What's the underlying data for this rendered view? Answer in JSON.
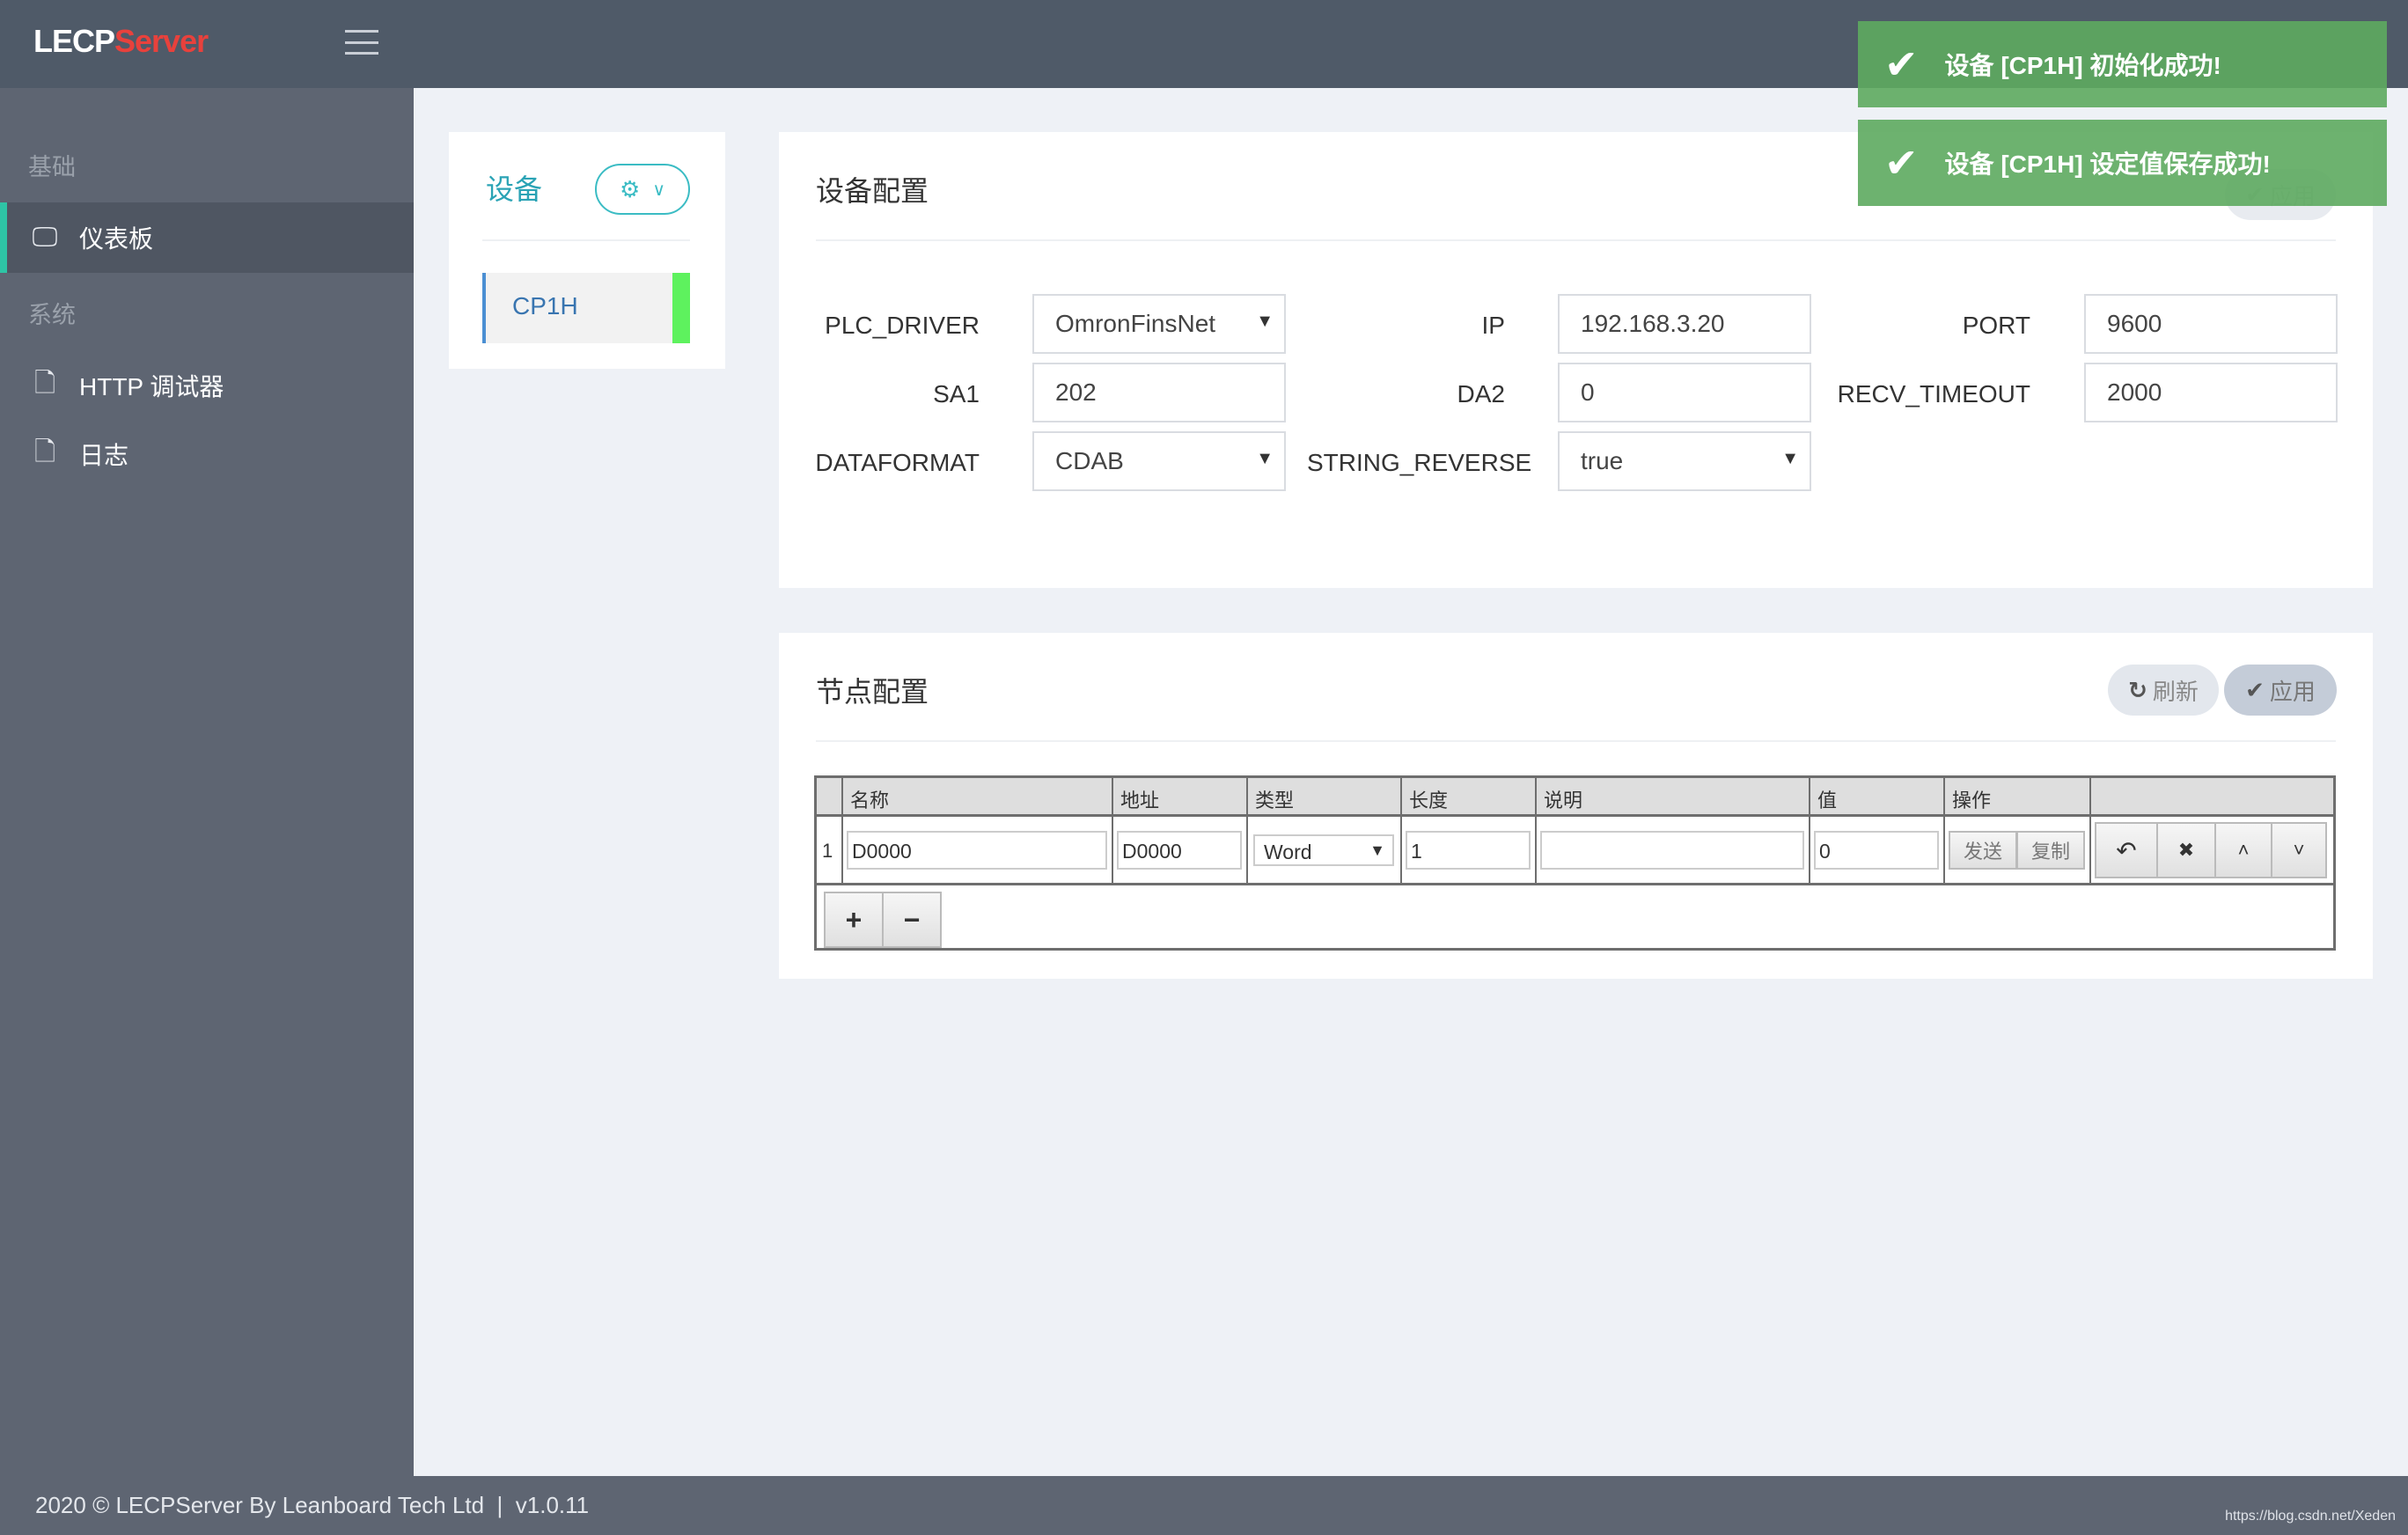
{
  "app": {
    "logo_part1": "LECP",
    "logo_part2": "Server"
  },
  "sidebar": {
    "section1": "基础",
    "section2": "系统",
    "items": [
      {
        "label": "仪表板",
        "icon": "monitor-icon"
      },
      {
        "label": "HTTP 调试器",
        "icon": "file-icon"
      },
      {
        "label": "日志",
        "icon": "file-icon"
      }
    ]
  },
  "devices": {
    "title": "设备",
    "items": [
      {
        "name": "CP1H",
        "status_color": "#5ef25e"
      }
    ]
  },
  "device_config": {
    "title": "设备配置",
    "apply_label": "应用",
    "fields": [
      {
        "label": "PLC_DRIVER",
        "value": "OmronFinsNet",
        "type": "select"
      },
      {
        "label": "IP",
        "value": "192.168.3.20",
        "type": "text"
      },
      {
        "label": "PORT",
        "value": "9600",
        "type": "text"
      },
      {
        "label": "SA1",
        "value": "202",
        "type": "text"
      },
      {
        "label": "DA2",
        "value": "0",
        "type": "text"
      },
      {
        "label": "RECV_TIMEOUT",
        "value": "2000",
        "type": "text"
      },
      {
        "label": "DATAFORMAT",
        "value": "CDAB",
        "type": "select"
      },
      {
        "label": "STRING_REVERSE",
        "value": "true",
        "type": "select"
      }
    ]
  },
  "node_config": {
    "title": "节点配置",
    "refresh_label": "刷新",
    "apply_label": "应用",
    "columns": [
      "名称",
      "地址",
      "类型",
      "长度",
      "说明",
      "值",
      "操作"
    ],
    "rows": [
      {
        "index": "1",
        "name": "D0000",
        "address": "D0000",
        "type": "Word",
        "length": "1",
        "desc": "",
        "value": "0",
        "send": "发送",
        "copy": "复制"
      }
    ]
  },
  "toasts": [
    "设备 [CP1H] 初始化成功!",
    "设备 [CP1H] 设定值保存成功!"
  ],
  "footer": {
    "text": "2020 © LECPServer By Leanboard Tech Ltd  |  v1.0.11",
    "watermark": "https://blog.csdn.net/Xeden"
  },
  "colors": {
    "header": "#4f5a68",
    "sidebar": "#5e6572",
    "accent": "#2ec4a5",
    "toast": "#5daa5f"
  }
}
